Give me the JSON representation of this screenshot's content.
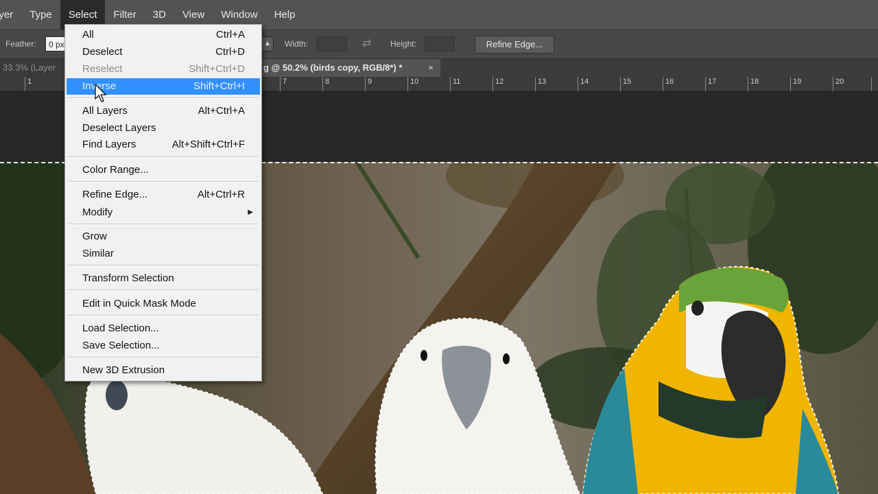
{
  "menubar": {
    "items": [
      "ayer",
      "Type",
      "Select",
      "Filter",
      "3D",
      "View",
      "Window",
      "Help"
    ],
    "active_index": 2
  },
  "options": {
    "feather_label": "Feather:",
    "feather_value": "0 px",
    "width_label": "Width:",
    "height_label": "Height:",
    "refine_button": "Refine Edge..."
  },
  "tabs": {
    "tab1": "33.3% (Layer",
    "tab2": "g @ 50.2% (birds copy, RGB/8*) *",
    "close": "×"
  },
  "ruler": {
    "labels": [
      "1",
      "7",
      "8",
      "9",
      "10",
      "11",
      "12",
      "13",
      "14",
      "15",
      "16",
      "17",
      "18",
      "19",
      "20"
    ]
  },
  "menu": {
    "items": [
      {
        "label": "All",
        "shortcut": "Ctrl+A"
      },
      {
        "label": "Deselect",
        "shortcut": "Ctrl+D"
      },
      {
        "label": "Reselect",
        "shortcut": "Shift+Ctrl+D"
      },
      {
        "label": "Inverse",
        "shortcut": "Shift+Ctrl+I"
      },
      {
        "label": "All Layers",
        "shortcut": "Alt+Ctrl+A"
      },
      {
        "label": "Deselect Layers",
        "shortcut": ""
      },
      {
        "label": "Find Layers",
        "shortcut": "Alt+Shift+Ctrl+F"
      },
      {
        "label": "Color Range...",
        "shortcut": ""
      },
      {
        "label": "Refine Edge...",
        "shortcut": "Alt+Ctrl+R"
      },
      {
        "label": "Modify",
        "shortcut": ""
      },
      {
        "label": "Grow",
        "shortcut": ""
      },
      {
        "label": "Similar",
        "shortcut": ""
      },
      {
        "label": "Transform Selection",
        "shortcut": ""
      },
      {
        "label": "Edit in Quick Mask Mode",
        "shortcut": ""
      },
      {
        "label": "Load Selection...",
        "shortcut": ""
      },
      {
        "label": "Save Selection...",
        "shortcut": ""
      },
      {
        "label": "New 3D Extrusion",
        "shortcut": ""
      }
    ],
    "disabled_index": 2,
    "highlight_index": 3,
    "submenu_index": 9
  },
  "colors": {
    "menu_highlight": "#3390ff",
    "menubar_bg": "#535353",
    "options_bg": "#484848"
  }
}
